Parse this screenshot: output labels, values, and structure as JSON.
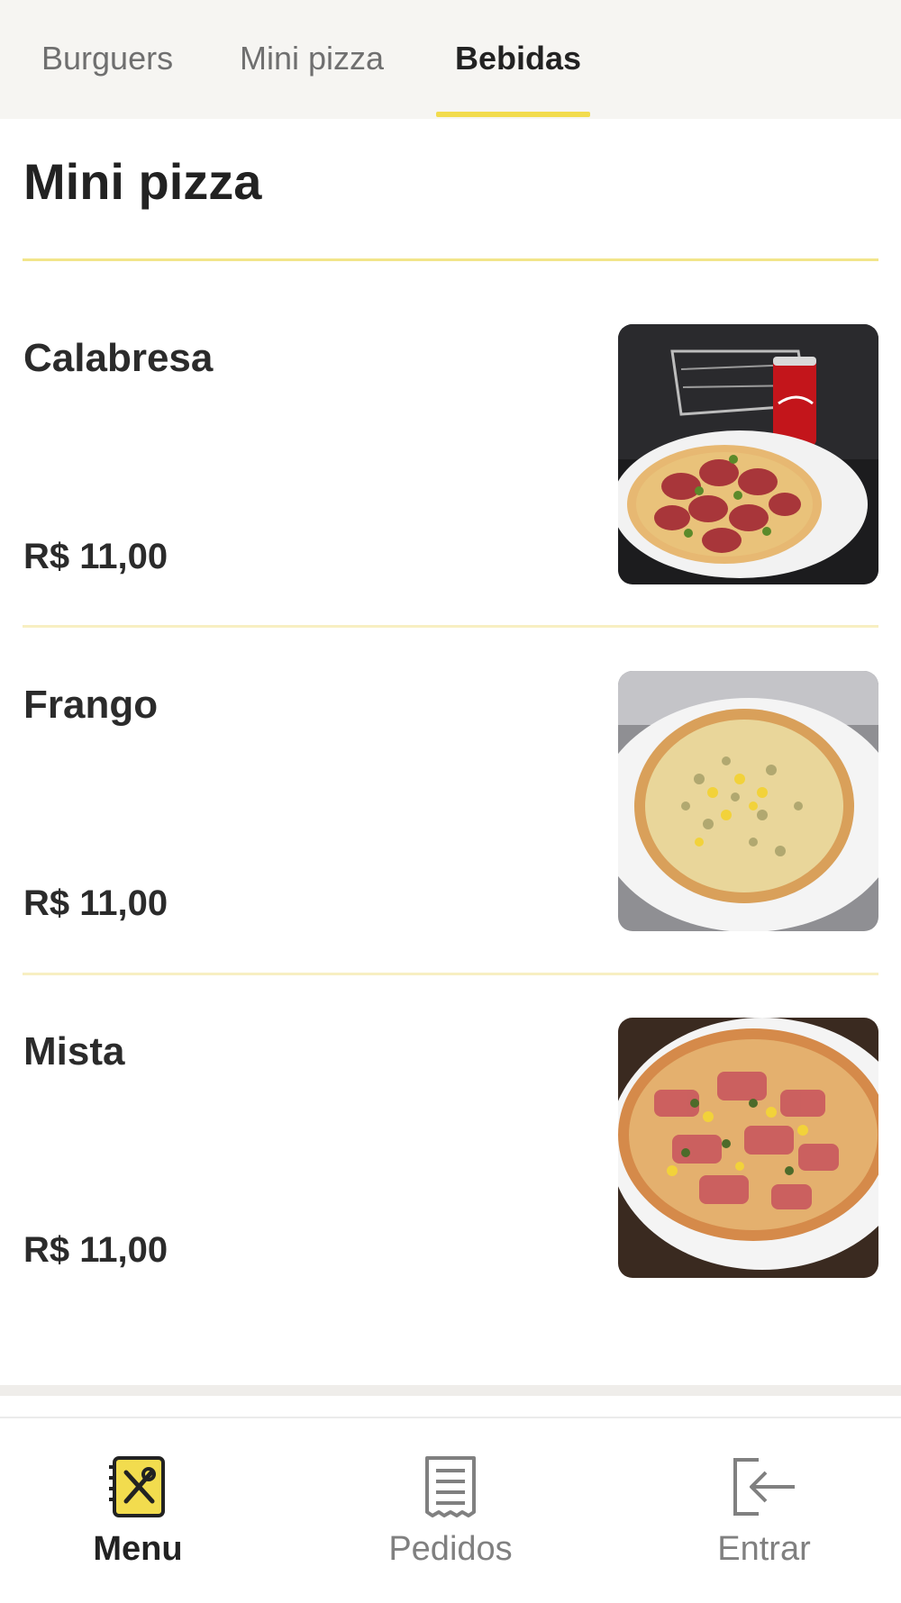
{
  "tabs": [
    {
      "label": "Burguers"
    },
    {
      "label": "Mini pizza"
    },
    {
      "label": "Bebidas"
    }
  ],
  "active_tab": "Bebidas",
  "section": {
    "title": "Mini pizza"
  },
  "products": [
    {
      "name": "Calabresa",
      "price": "R$ 11,00",
      "image": "calabresa-pizza-photo"
    },
    {
      "name": "Frango",
      "price": "R$ 11,00",
      "image": "frango-pizza-photo"
    },
    {
      "name": "Mista",
      "price": "R$ 11,00",
      "image": "mista-pizza-photo"
    }
  ],
  "bottom_nav": [
    {
      "label": "Menu",
      "icon": "menu-book-icon",
      "active": true
    },
    {
      "label": "Pedidos",
      "icon": "receipt-icon",
      "active": false
    },
    {
      "label": "Entrar",
      "icon": "login-icon",
      "active": false
    }
  ],
  "colors": {
    "accent": "#f2dc4e",
    "tabbar_bg": "#f6f5f2",
    "text_dark": "#222222",
    "text_muted": "#808080"
  }
}
